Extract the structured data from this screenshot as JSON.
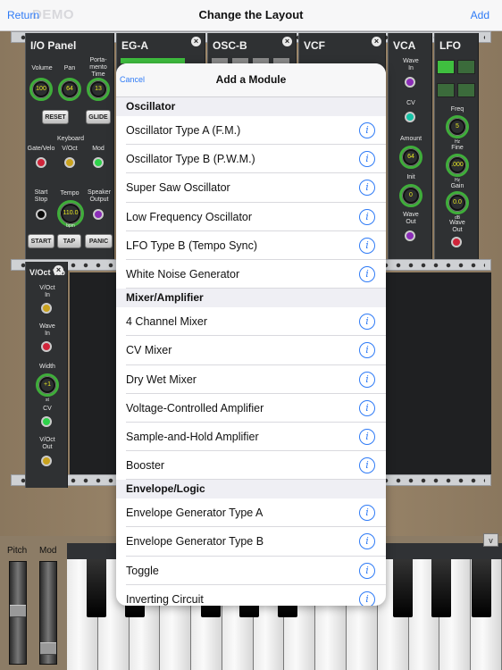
{
  "navbar": {
    "return_label": "Return",
    "demo_label": "DEMO",
    "title": "Change the Layout",
    "add_label": "Add"
  },
  "modules": {
    "io_panel": {
      "title": "I/O Panel",
      "volume_label": "Volume",
      "volume_value": "100",
      "pan_label": "Pan",
      "pan_value": "64",
      "portamento_label": "Porta-\nmento\nTime",
      "portamento_value": "13",
      "reset_label": "RESET",
      "glide_label": "GLIDE",
      "keyboard_label": "Keyboard",
      "gate_label": "Gate/Velo",
      "voct_label": "V/Oct",
      "mod_label": "Mod",
      "start_stop_label": "Start\nStop",
      "tempo_label": "Tempo",
      "tempo_value": "110.0",
      "tempo_unit": "bpm",
      "speaker_label": "Speaker\nOutput",
      "start_label": "START",
      "tap_label": "TAP",
      "panic_label": "PANIC"
    },
    "eg_a": {
      "title": "EG-A"
    },
    "osc_b": {
      "title": "OSC-B"
    },
    "vcf": {
      "title": "VCF"
    },
    "vca": {
      "title": "VCA",
      "wave_in_label": "Wave\nIn",
      "cv_label": "CV",
      "amount_label": "Amount",
      "amount_value": "64",
      "init_label": "Init",
      "init_value": "0",
      "wave_out_label": "Wave\nOut"
    },
    "lfo": {
      "title": "LFO",
      "freq_label": "Freq",
      "freq_value": "5",
      "freq_unit": "Hz",
      "fine_label": "Fine",
      "fine_value": ".000",
      "fine_unit": "Hz",
      "gain_label": "Gain",
      "gain_value": "0.0",
      "gain_unit": "dB",
      "wave_out_label": "Wave\nOut"
    },
    "voct_vib": {
      "title": "V/Oct Vib",
      "voct_in_label": "V/Oct\nIn",
      "wave_in_label": "Wave\nIn",
      "width_label": "Width",
      "width_value": "+1",
      "width_unit": "st",
      "cv_label": "CV",
      "voct_out_label": "V/Oct\nOut"
    }
  },
  "sheet": {
    "cancel_label": "Cancel",
    "title": "Add a Module",
    "info_glyph": "i",
    "sections": [
      {
        "header": "Oscillator",
        "items": [
          "Oscillator Type A (F.M.)",
          "Oscillator Type B (P.W.M.)",
          "Super Saw Oscillator",
          "Low Frequency Oscillator",
          "LFO Type B (Tempo Sync)",
          "White Noise Generator"
        ]
      },
      {
        "header": "Mixer/Amplifier",
        "items": [
          "4 Channel Mixer",
          "CV Mixer",
          "Dry Wet Mixer",
          "Voltage-Controlled Amplifier",
          "Sample-and-Hold Amplifier",
          "Booster"
        ]
      },
      {
        "header": "Envelope/Logic",
        "items": [
          "Envelope Generator Type A",
          "Envelope Generator Type B",
          "Toggle",
          "Inverting Circuit"
        ]
      }
    ]
  },
  "keyboard": {
    "pitch_label": "Pitch",
    "mod_label": "Mod",
    "collapse_glyph": "v"
  }
}
